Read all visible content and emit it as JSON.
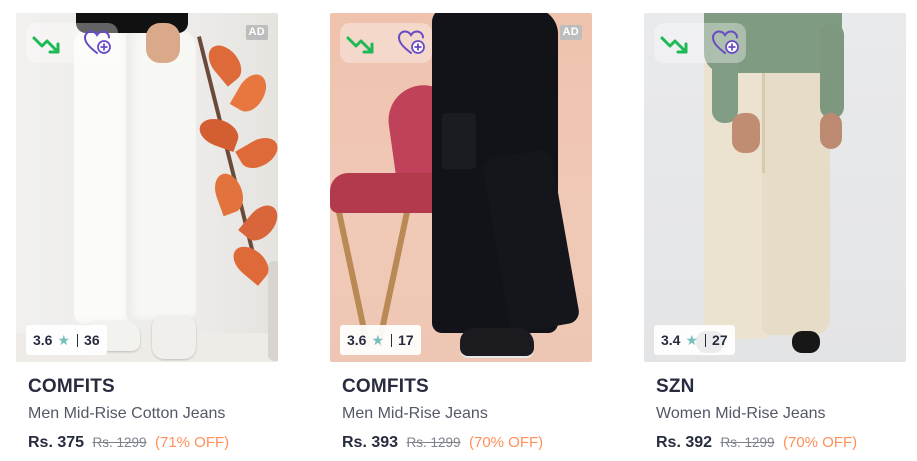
{
  "products": [
    {
      "brand": "COMFITS",
      "name": "Men Mid-Rise Cotton Jeans",
      "price": "Rs. 375",
      "mrp": "Rs. 1299",
      "discount": "(71% OFF)",
      "rating": "3.6",
      "rating_count": "36",
      "ad_label": "AD",
      "trend_icon": "price-drop-icon",
      "wishlist_icon": "wishlist-heart-plus-icon"
    },
    {
      "brand": "COMFITS",
      "name": "Men Mid-Rise Jeans",
      "price": "Rs. 393",
      "mrp": "Rs. 1299",
      "discount": "(70% OFF)",
      "rating": "3.6",
      "rating_count": "17",
      "ad_label": "AD",
      "trend_icon": "price-drop-icon",
      "wishlist_icon": "wishlist-heart-plus-icon"
    },
    {
      "brand": "SZN",
      "name": "Women Mid-Rise Jeans",
      "price": "Rs. 392",
      "mrp": "Rs. 1299",
      "discount": "(70% OFF)",
      "rating": "3.4",
      "rating_count": "27",
      "trend_icon": "price-drop-icon",
      "wishlist_icon": "wishlist-heart-plus-icon"
    }
  ],
  "colors": {
    "brand_text": "#282c3f",
    "name_text": "#535766",
    "mrp_text": "#7e818c",
    "discount_text": "#ff905a",
    "rating_star": "#72bfbc",
    "trend_green": "#1db954",
    "wishlist_purple": "#6a4cc2"
  }
}
